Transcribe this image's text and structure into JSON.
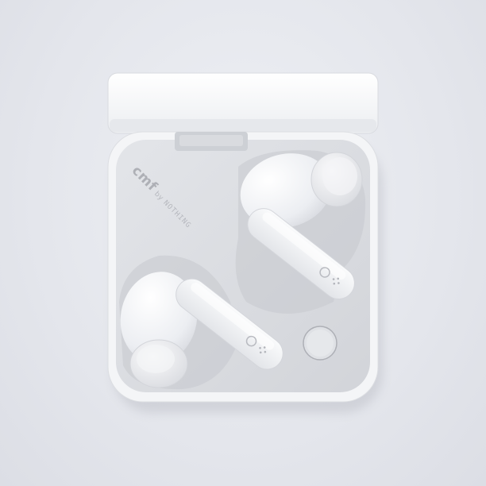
{
  "brand": {
    "name": "cmf",
    "by": "by",
    "maker": "NOTHING"
  },
  "colors": {
    "background": "#e6e8ee",
    "case_white": "#f6f7f9",
    "tray_grey": "#d8dade",
    "earbud_white": "#f1f2f5"
  }
}
